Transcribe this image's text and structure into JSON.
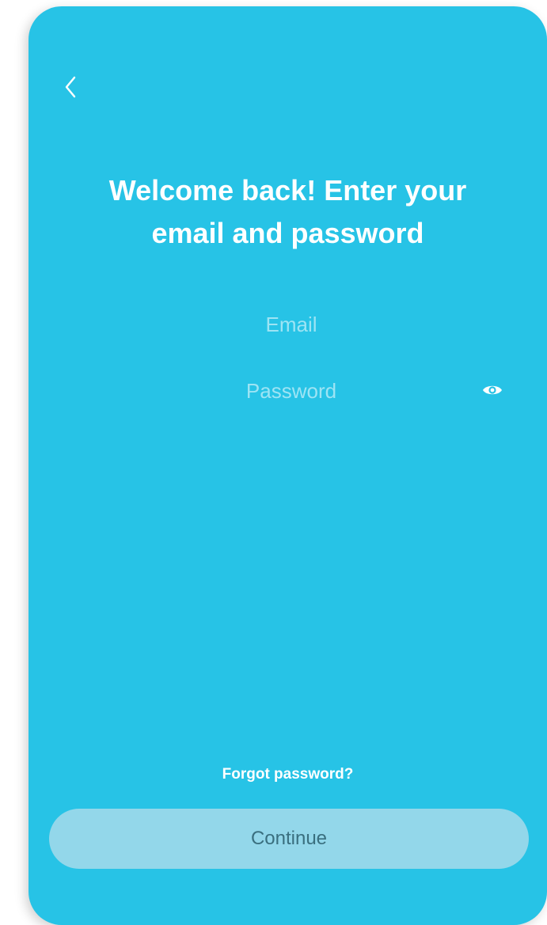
{
  "header": {
    "back_icon": "chevron-left-icon"
  },
  "title": {
    "line1": "Welcome back! Enter your",
    "line2": "email and password"
  },
  "form": {
    "email": {
      "value": "",
      "placeholder": "Email"
    },
    "password": {
      "value": "",
      "placeholder": "Password",
      "visibility_icon": "eye-icon"
    }
  },
  "links": {
    "forgot_password": "Forgot password?"
  },
  "actions": {
    "continue_label": "Continue"
  },
  "colors": {
    "background": "#27c3e6",
    "text": "#ffffff",
    "button_disabled": "#93d7ea",
    "button_text": "#3a6f7f"
  }
}
